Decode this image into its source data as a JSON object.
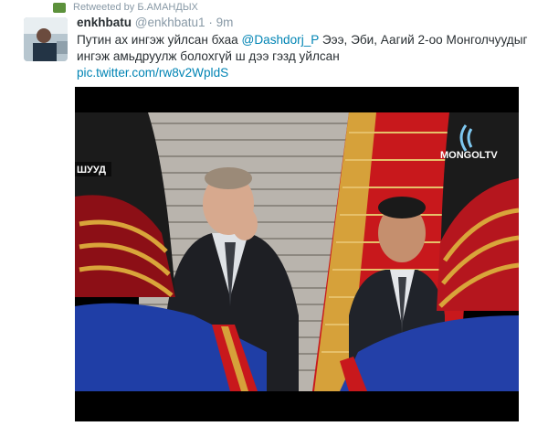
{
  "retweet": {
    "icon": "retweet-icon",
    "text": "Retweeted by Б.АМАНДЫХ"
  },
  "tweet": {
    "author_name": "enkhbatu",
    "author_handle": "@enkhbatu1",
    "separator": "·",
    "time": "9m",
    "text_part1": "Путин ах ингэж уйлсан бхаа ",
    "mention": "@Dashdorj_P",
    "text_part2": " Эээ, Эби, Аагий 2-оо Монголчуудыг ингэж амьдруулж болохгүй ш дээ гэзд уйлсан",
    "link": "pic.twitter.com/rw8v2WpldS"
  },
  "media": {
    "overlay_left": "ШУУД",
    "overlay_logo": "MONGOLTV"
  }
}
